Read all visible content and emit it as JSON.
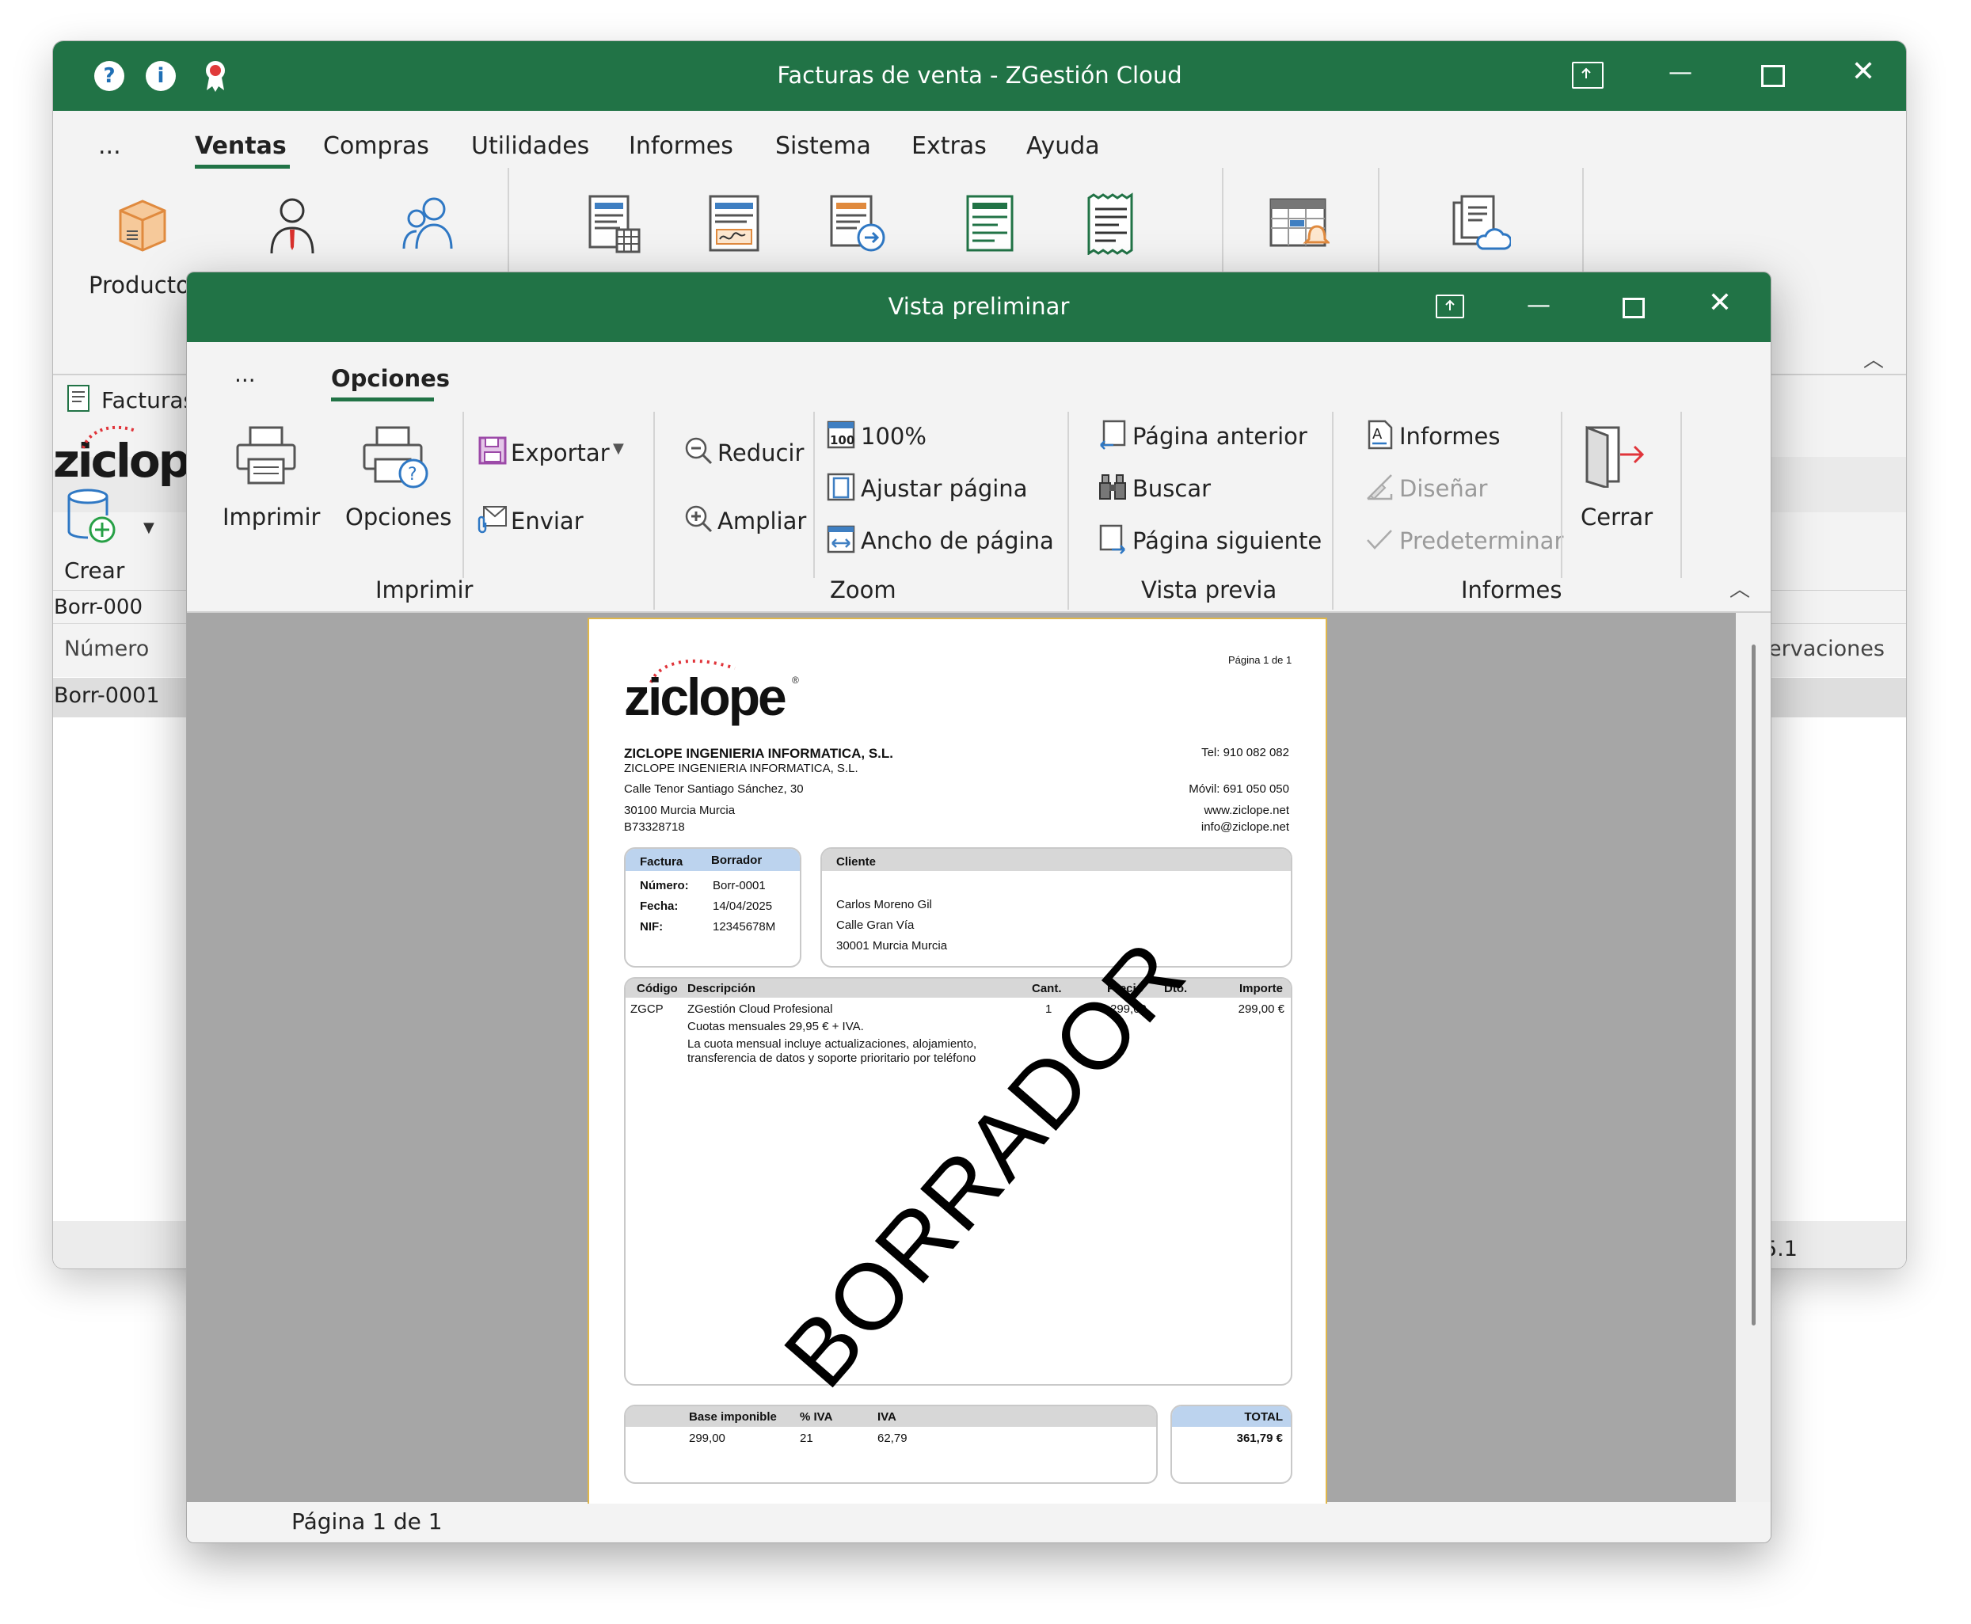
{
  "main_window": {
    "title": "Facturas de venta - ZGestión Cloud",
    "menu": [
      "...",
      "Ventas",
      "Compras",
      "Utilidades",
      "Informes",
      "Sistema",
      "Extras",
      "Ayuda"
    ],
    "active_tab": "Ventas",
    "ribbon_first_label": "Productos",
    "doc_tab_label": "Facturas",
    "logo_text": "ziclope",
    "create_label": "Crear",
    "list_header_number": "Número",
    "list_header_observations": "ervaciones",
    "list_first_value": "Borr-000",
    "list_row_value": "Borr-0001",
    "status_fragment": "5.1",
    "accent_color": "#217346"
  },
  "dialog": {
    "title": "Vista preliminar",
    "menu_more": "...",
    "tab_options": "Opciones",
    "buttons": {
      "print": "Imprimir",
      "options": "Opciones",
      "export": "Exportar",
      "send": "Enviar",
      "reduce": "Reducir",
      "enlarge": "Ampliar",
      "zoom100": "100%",
      "fit_page": "Ajustar página",
      "page_width": "Ancho de página",
      "prev_page": "Página anterior",
      "search": "Buscar",
      "next_page": "Página siguiente",
      "reports": "Informes",
      "design": "Diseñar",
      "default": "Predeterminar",
      "close": "Cerrar"
    },
    "groups": {
      "print": "Imprimir",
      "zoom": "Zoom",
      "preview": "Vista previa",
      "reports": "Informes"
    },
    "status": "Página 1 de 1"
  },
  "invoice": {
    "page_label": "Página 1 de 1",
    "logo": "ziclope",
    "company_bold": "ZICLOPE INGENIERIA INFORMATICA, S.L.",
    "company_name": "ZICLOPE INGENIERIA INFORMATICA, S.L.",
    "address1": "Calle Tenor Santiago Sánchez, 30",
    "address2": "30100 Murcia Murcia",
    "cif": "B73328718",
    "tel": "Tel: 910 082 082",
    "mobile": "Móvil: 691 050 050",
    "web": "www.ziclope.net",
    "email": "info@ziclope.net",
    "invoice_box": {
      "header_label": "Factura",
      "header_value": "Borrador",
      "number_label": "Número:",
      "number": "Borr-0001",
      "date_label": "Fecha:",
      "date": "14/04/2025",
      "nif_label": "NIF:",
      "nif": "12345678M"
    },
    "client_box": {
      "header": "Cliente",
      "name": "Carlos Moreno Gil",
      "street": "Calle Gran Vía",
      "city": "30001 Murcia Murcia"
    },
    "lines_header": {
      "code": "Código",
      "description": "Descripción",
      "qty": "Cant.",
      "price": "Precio",
      "discount": "Dto.",
      "amount": "Importe"
    },
    "line": {
      "code": "ZGCP",
      "desc1": "ZGestión Cloud Profesional",
      "desc2": "Cuotas mensuales 29,95 € + IVA.",
      "desc3": "La cuota mensual incluye actualizaciones, alojamiento,",
      "desc4": "transferencia de datos y soporte prioritario por teléfono",
      "qty": "1",
      "price": "299,00",
      "amount": "299,00 €"
    },
    "watermark": "BORRADOR",
    "totals": {
      "base_label": "Base imponible",
      "vat_pct_label": "% IVA",
      "vat_label": "IVA",
      "base": "299,00",
      "vat_pct": "21",
      "vat": "62,79",
      "total_label": "TOTAL",
      "total": "361,79 €"
    }
  }
}
